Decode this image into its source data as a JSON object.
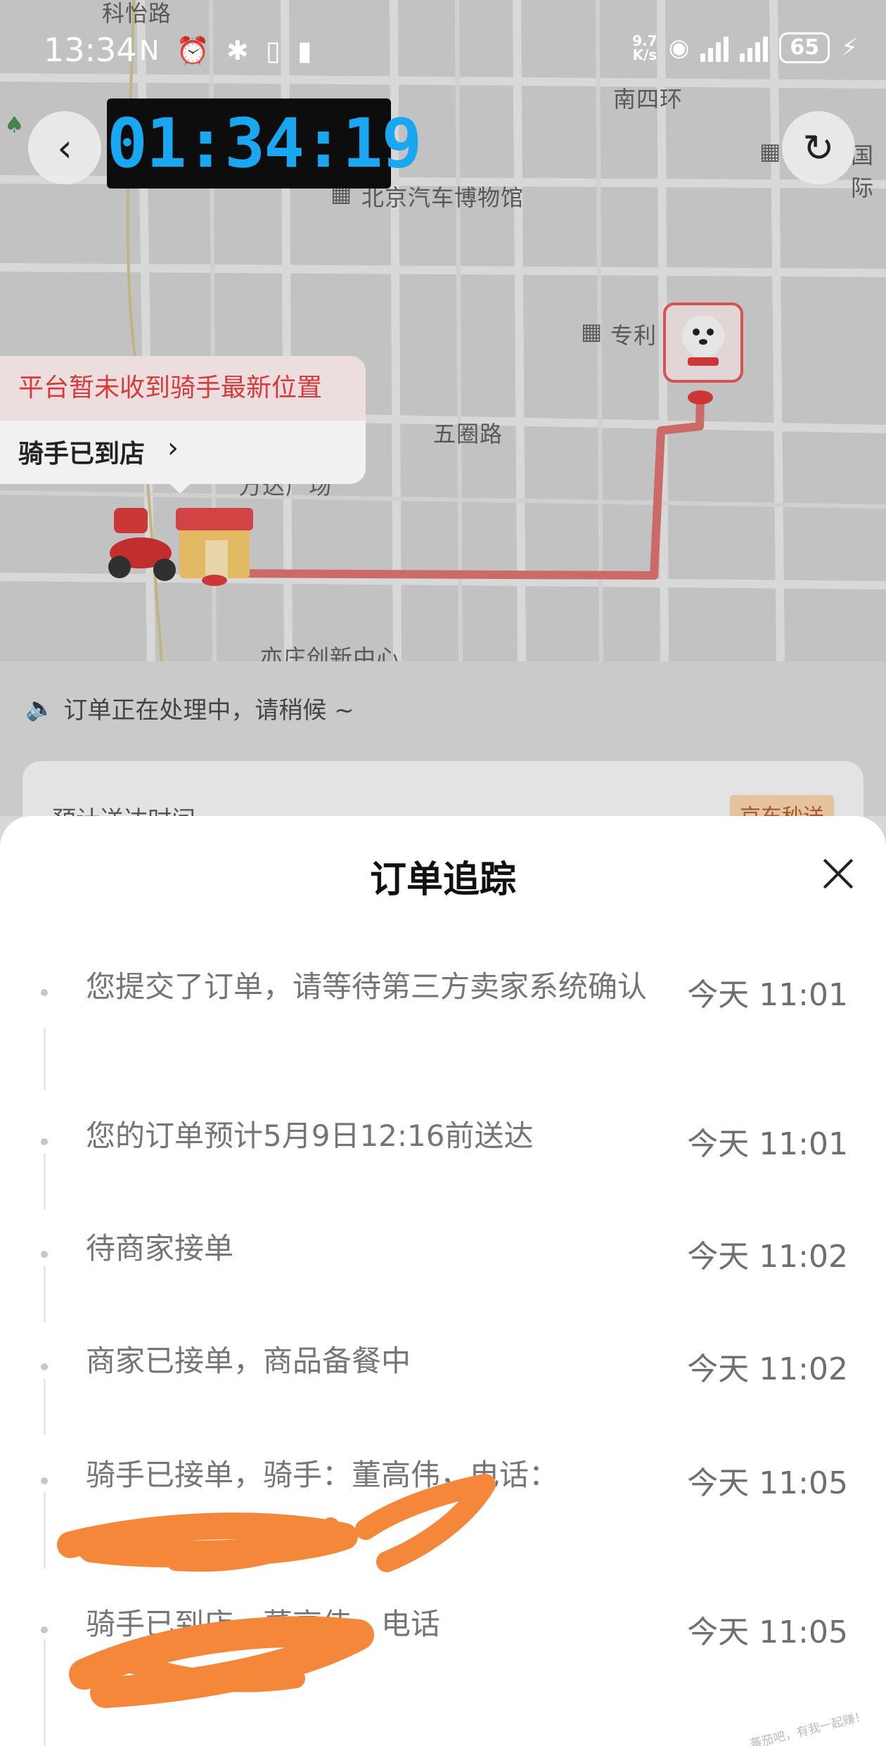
{
  "status_bar": {
    "time": "13:34",
    "left_icons": "N ⏰ ✱ ▯ ▮",
    "netspeed_value": "9.7",
    "netspeed_unit": "K/s",
    "battery": "65"
  },
  "timer": "01:34:19",
  "map": {
    "labels": [
      "科怡路",
      "南四环",
      "北京汽车博物馆",
      "专利",
      "五圈路",
      "万达广场",
      "亦庄创新中心",
      "国际"
    ]
  },
  "rider_bubble": {
    "warning": "平台暂未收到骑手最新位置",
    "status": "骑手已到店",
    "chevron": "›"
  },
  "notice": "订单正在处理中，请稍候 ~",
  "underlying_card": {
    "label": "预计送达时间",
    "badge": "京东秒送"
  },
  "sheet": {
    "title": "订单追踪",
    "events": [
      {
        "text": "您提交了订单，请等待第三方卖家系统确认",
        "time": "今天 11:01"
      },
      {
        "text": "您的订单预计5月9日12:16前送达",
        "time": "今天 11:01"
      },
      {
        "text": "待商家接单",
        "time": "今天 11:02"
      },
      {
        "text": "商家已接单，商品备餐中",
        "time": "今天 11:02"
      },
      {
        "text": "骑手已接单，骑手：董高伟，电话：",
        "time": "今天 11:05"
      },
      {
        "text": "骑手已到店，董高伟，电话",
        "time": "今天 11:05"
      }
    ]
  },
  "watermark": "蕃茄吧，有我一起赚！"
}
